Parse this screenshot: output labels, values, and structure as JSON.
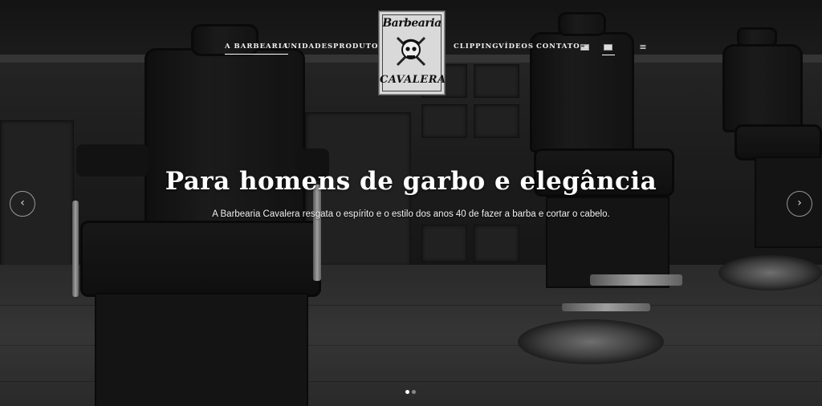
{
  "nav": {
    "items": [
      {
        "label": "A BARBEARIA",
        "active": true
      },
      {
        "label": "UNIDADES",
        "active": false
      },
      {
        "label": "PRODUTOS",
        "active": false
      },
      {
        "label": "CLIPPING",
        "active": false
      },
      {
        "label": "VÍDEOS",
        "active": false
      },
      {
        "label": "CONTATO",
        "active": false
      }
    ],
    "language_icons": [
      "us-flag-icon",
      "brazil-flag-icon"
    ],
    "menu_icon": "hamburger-menu-icon"
  },
  "logo": {
    "line1": "Barbearia",
    "line2": "CAVALERA",
    "emblem_icon": "skull-razor-emblem-icon"
  },
  "hero": {
    "headline": "Para homens de garbo e elegância",
    "subline": "A Barbearia Cavalera resgata o espírito e o estilo dos anos 40 de fazer a barba e cortar o cabelo."
  },
  "slider": {
    "prev_icon": "chevron-left-icon",
    "next_icon": "chevron-right-icon",
    "prev_glyph": "‹",
    "next_glyph": "›",
    "slide_count": 2,
    "active_slide": 1
  },
  "colors": {
    "text": "#ffffff",
    "logo_background": "#d9d9d9",
    "dot_active": "#ffffff",
    "dot_inactive": "#888888"
  }
}
